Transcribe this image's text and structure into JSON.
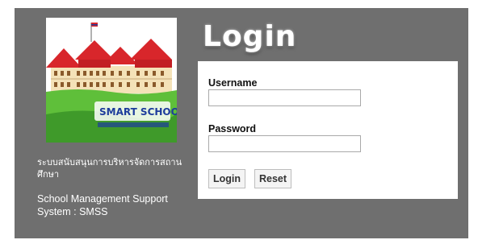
{
  "branding": {
    "logo_text": "SMART SCHOOL",
    "thai_name": "ระบบสนับสนุนการบริหารจัดการสถานศึกษา",
    "english_name": "School Management Support System : SMSS"
  },
  "login": {
    "title": "Login",
    "username_label": "Username",
    "username_value": "",
    "password_label": "Password",
    "password_value": "",
    "login_button": "Login",
    "reset_button": "Reset"
  },
  "colors": {
    "panel_bg": "#6f6f6f",
    "roof": "#d8262b",
    "grass": "#5fbf3a"
  }
}
